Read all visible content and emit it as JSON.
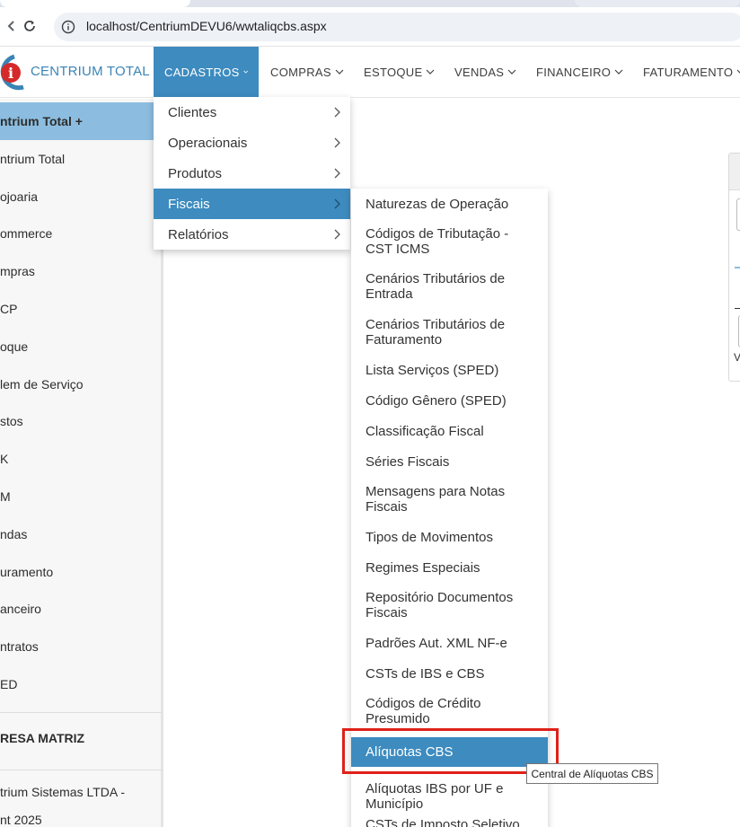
{
  "browser": {
    "url": "localhost/CentriumDEVU6/wwtaliqcbs.aspx",
    "icons": {
      "refresh": "refresh-icon",
      "info": "site-info-icon"
    }
  },
  "app": {
    "brand": "CENTRIUM TOTAL +",
    "logo_letter": "i",
    "colors": {
      "accent": "#3d8bbf",
      "brand_text": "#3a84b5",
      "sidebar_active": "#8cbde0",
      "highlight": "#e0201a",
      "logo_red": "#d42a2a"
    }
  },
  "topmenu": [
    {
      "label": "CADASTROS",
      "active": true
    },
    {
      "label": "COMPRAS"
    },
    {
      "label": "ESTOQUE"
    },
    {
      "label": "VENDAS"
    },
    {
      "label": "FINANCEIRO"
    },
    {
      "label": "FATURAMENTO"
    }
  ],
  "sidebar": {
    "items": [
      {
        "label": "ntrium Total +",
        "active": true
      },
      {
        "label": "ntrium Total"
      },
      {
        "label": "ojoaria"
      },
      {
        "label": "ommerce"
      },
      {
        "label": "mpras"
      },
      {
        "label": "CP"
      },
      {
        "label": "oque"
      },
      {
        "label": "lem de Serviço"
      },
      {
        "label": "stos"
      },
      {
        "label": "K"
      },
      {
        "label": "M"
      },
      {
        "label": "ndas"
      },
      {
        "label": "uramento"
      },
      {
        "label": "anceiro"
      },
      {
        "label": "ntratos"
      },
      {
        "label": "ED"
      }
    ],
    "company": "RESA MATRIZ",
    "footer_line1": "trium Sistemas LTDA -",
    "footer_line2": "nt 2025"
  },
  "cadastros_menu": [
    {
      "label": "Clientes"
    },
    {
      "label": "Operacionais"
    },
    {
      "label": "Produtos"
    },
    {
      "label": "Fiscais",
      "active": true
    },
    {
      "label": "Relatórios"
    }
  ],
  "fiscais_menu": [
    {
      "label": "Naturezas de Operação"
    },
    {
      "label": "Códigos de Tributação - CST ICMS"
    },
    {
      "label": "Cenários Tributários de Entrada"
    },
    {
      "label": "Cenários Tributários de Faturamento"
    },
    {
      "label": "Lista Serviços (SPED)"
    },
    {
      "label": "Código Gênero (SPED)"
    },
    {
      "label": "Classificação Fiscal"
    },
    {
      "label": "Séries Fiscais"
    },
    {
      "label": "Mensagens para Notas Fiscais"
    },
    {
      "label": "Tipos de Movimentos"
    },
    {
      "label": "Regimes Especiais"
    },
    {
      "label": "Repositório Documentos Fiscais"
    },
    {
      "label": "Padrões Aut. XML NF-e"
    },
    {
      "label": "CSTs de IBS e CBS"
    },
    {
      "label": "Códigos de Crédito Presumido"
    },
    {
      "label": "Alíquotas CBS",
      "active": true
    },
    {
      "label": "Alíquotas IBS por UF e Município"
    },
    {
      "label": "CSTs de Imposto Seletivo"
    }
  ],
  "tooltip": "Central de Alíquotas CBS",
  "right_panel_fragment": "V"
}
